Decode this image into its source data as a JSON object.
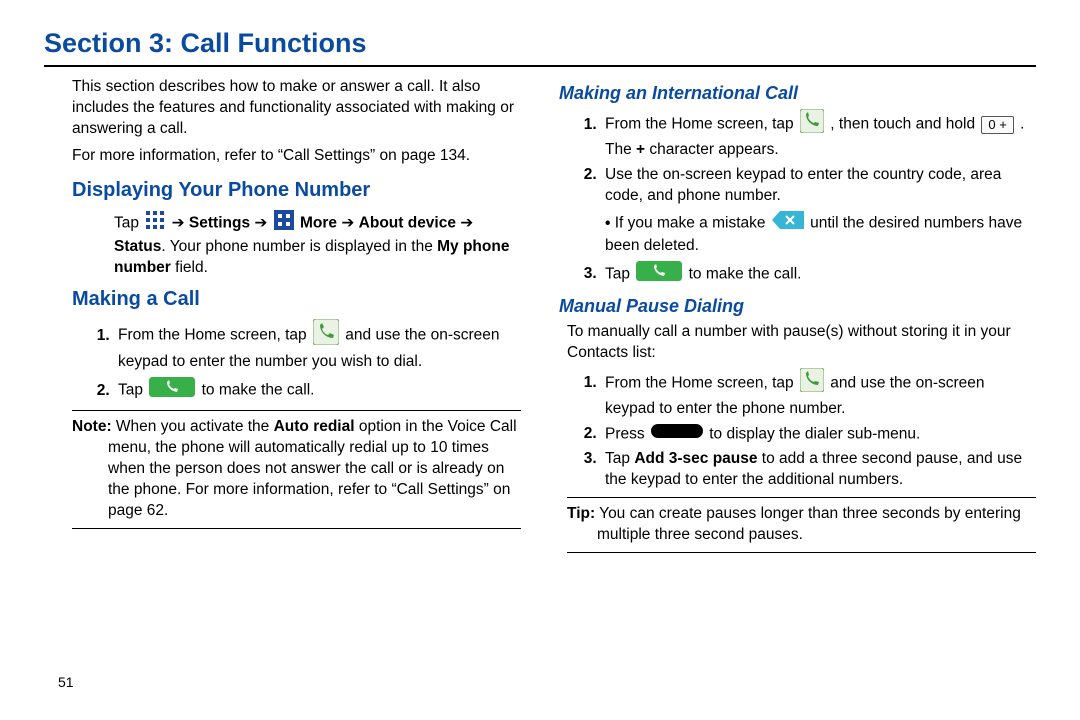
{
  "title": "Section 3: Call Functions",
  "intro_p1": "This section describes how to make or answer a call. It also includes the features and functionality associated with making or answering a call.",
  "intro_p2_pre": "For more information, refer to ",
  "intro_p2_ref": "“Call Settings”",
  "intro_p2_post": "on page 134.",
  "h_display": "Displaying Your Phone Number",
  "display_tap": "Tap ",
  "display_settings": "Settings",
  "display_more": "More",
  "display_about": "About device",
  "display_status_pre": "Status",
  "display_status_mid": ". Your phone number is displayed in the ",
  "display_my": "My phone number",
  "display_field": " field.",
  "h_making": "Making a Call",
  "making_step1_a": "From the Home screen, tap ",
  "making_step1_b": " and use the on-screen keypad to enter the number you wish to dial.",
  "making_step2_a": "Tap ",
  "making_step2_b": " to make the call.",
  "note_label": "Note:",
  "note_body_a": "When you activate the ",
  "note_auto": "Auto redial",
  "note_body_b": " option in the Voice Call menu, the phone will automatically redial up to 10 times when the person does not answer the call or is already on the phone. For more information, refer to ",
  "note_ref": "“Call Settings”",
  "note_body_c": " on page 62.",
  "h_intl": "Making an International Call",
  "intl_step1_a": "From the Home screen, tap ",
  "intl_step1_b": ", then touch and hold ",
  "intl_step1_c": ". The ",
  "intl_step1_plus": "+",
  "intl_step1_d": " character appears.",
  "intl_step2": "Use the on-screen keypad to enter the country code, area code, and phone number.",
  "intl_sub_a": "If you make a mistake",
  "intl_sub_b": " until the desired numbers have been deleted.",
  "intl_step3_a": "Tap ",
  "intl_step3_b": " to make the call.",
  "h_pause": "Manual Pause Dialing",
  "pause_intro": "To manually call a number with pause(s) without storing it in your Contacts list:",
  "pause_step1_a": "From the Home screen, tap ",
  "pause_step1_b": " and use the on-screen keypad to enter the phone number.",
  "pause_step2_a": "Press ",
  "pause_step2_b": " to display the dialer sub-menu.",
  "pause_step3_a": "Tap ",
  "pause_add3": "Add 3-sec pause",
  "pause_step3_b": " to add a three second pause, and use the keypad to enter the additional numbers.",
  "tip_label": "Tip:",
  "tip_body": " You can create pauses longer than three seconds by entering multiple three second pauses.",
  "zero_key": "0 +",
  "page_number": "51"
}
